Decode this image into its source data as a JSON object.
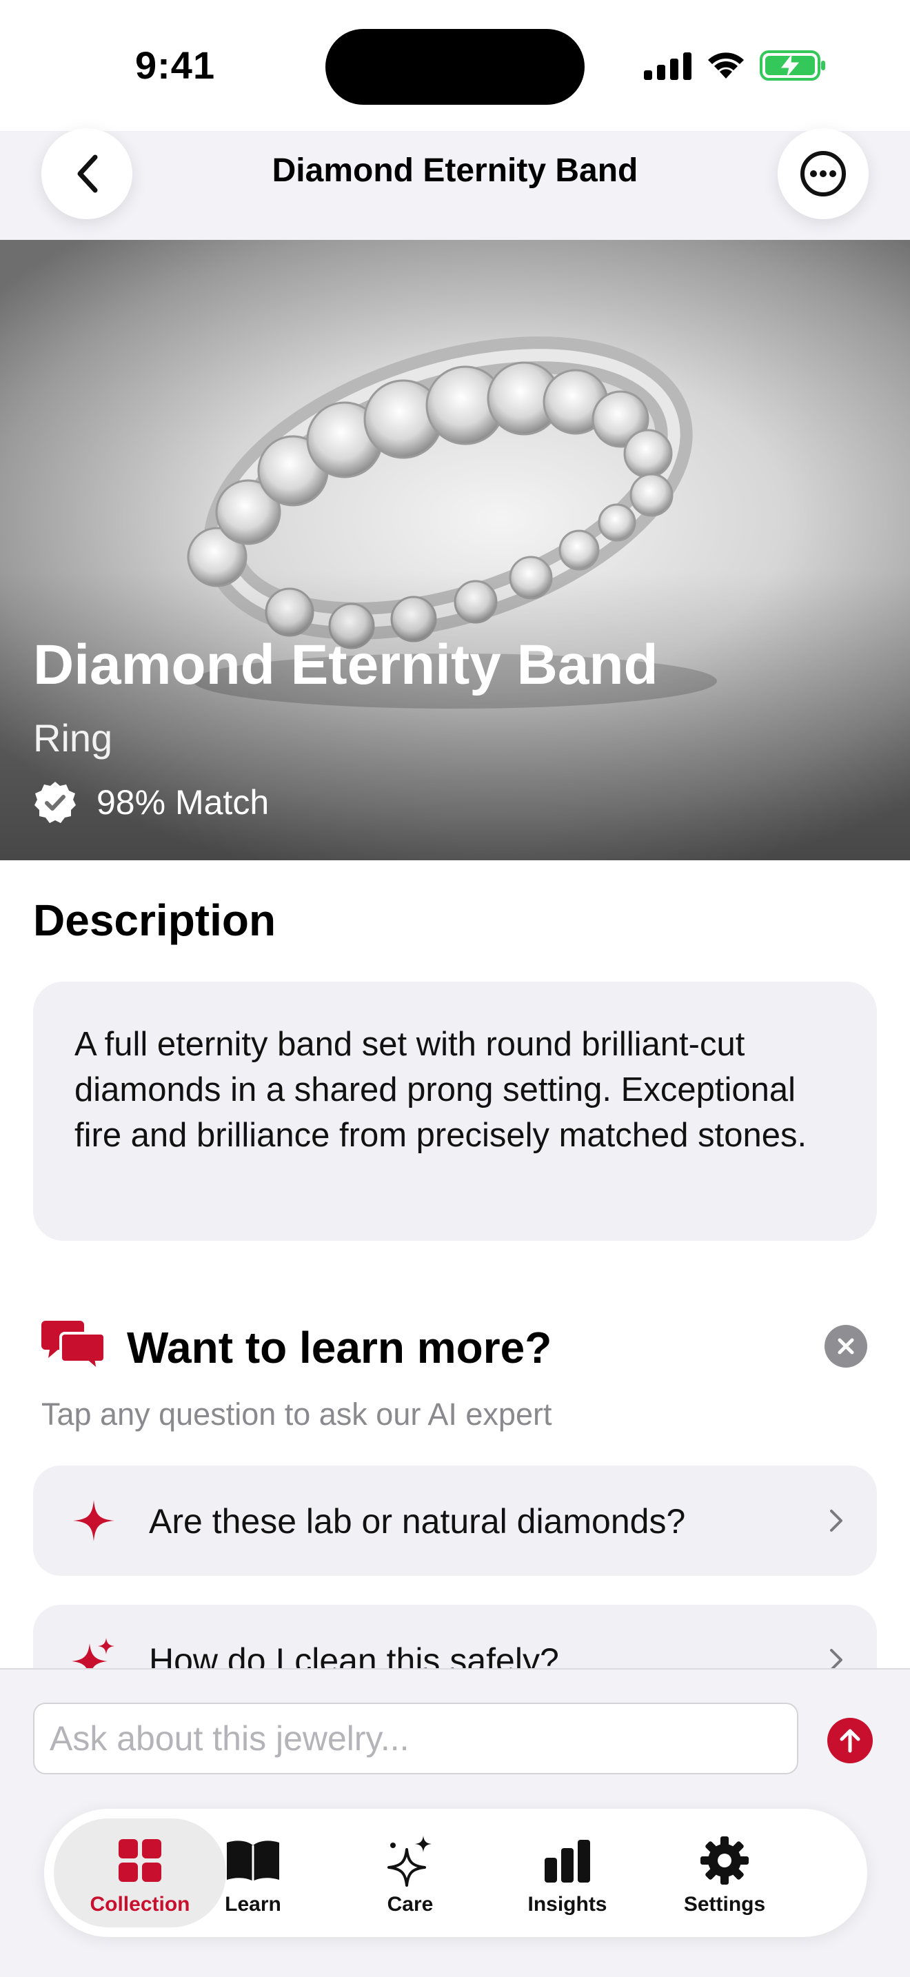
{
  "status_bar": {
    "time": "9:41"
  },
  "nav": {
    "title": "Diamond Eternity Band"
  },
  "hero": {
    "title": "Diamond Eternity Band",
    "category": "Ring",
    "match": "98% Match"
  },
  "description": {
    "heading": "Description",
    "text": "A full eternity band set with round brilliant-cut diamonds in a shared prong setting. Exceptional fire and brilliance from precisely matched stones."
  },
  "learn_more": {
    "title": "Want to learn more?",
    "subtitle": "Tap any question to ask our AI expert",
    "questions": [
      {
        "label": "Are these lab or natural diamonds?"
      },
      {
        "label": "How do I clean this safely?"
      }
    ]
  },
  "ask": {
    "placeholder": "Ask about this jewelry...",
    "value": ""
  },
  "tabs": [
    {
      "label": "Collection",
      "icon": "grid-icon",
      "active": true
    },
    {
      "label": "Learn",
      "icon": "book-icon",
      "active": false
    },
    {
      "label": "Care",
      "icon": "sparkles-icon",
      "active": false
    },
    {
      "label": "Insights",
      "icon": "bar-chart-icon",
      "active": false
    },
    {
      "label": "Settings",
      "icon": "gear-icon",
      "active": false
    }
  ],
  "colors": {
    "accent": "#c8102e",
    "battery": "#34c759",
    "card_bg": "#f0f0f5"
  }
}
